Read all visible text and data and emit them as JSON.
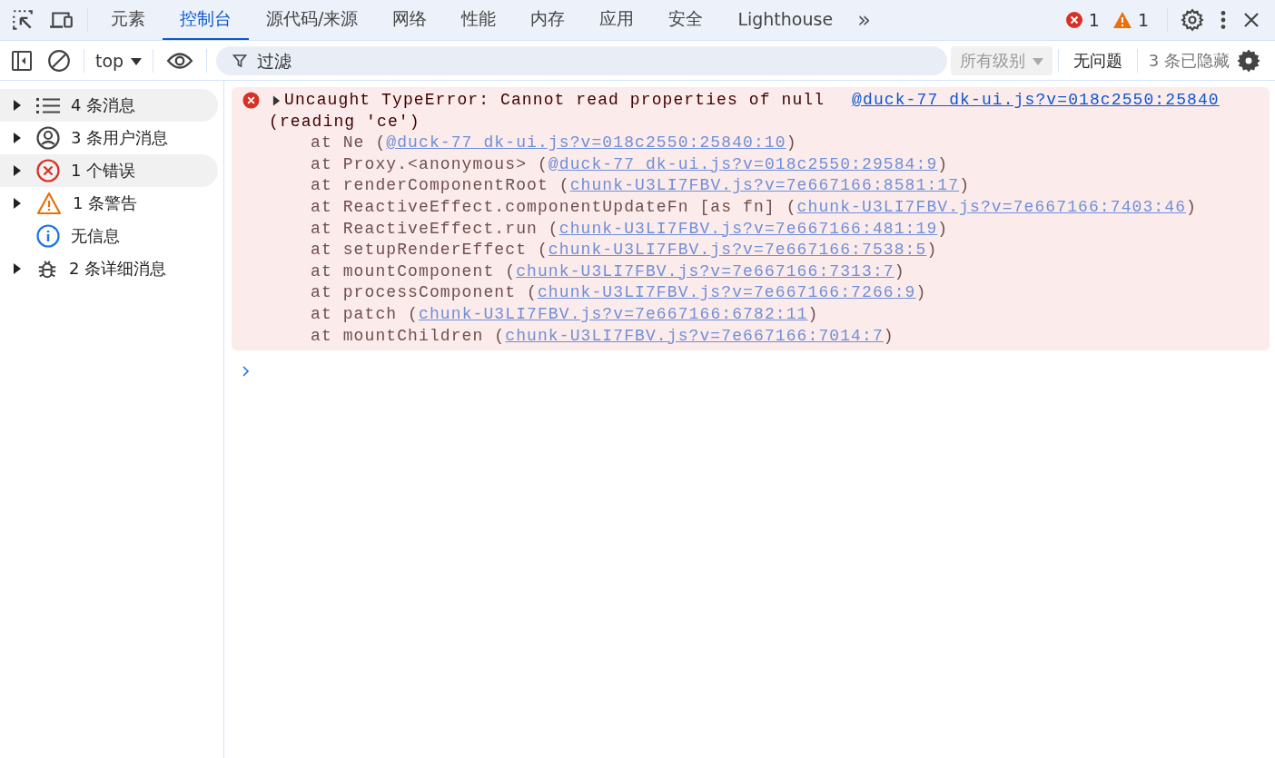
{
  "tabs": [
    {
      "label": "元素",
      "selected": false
    },
    {
      "label": "控制台",
      "selected": true
    },
    {
      "label": "源代码/来源",
      "selected": false
    },
    {
      "label": "网络",
      "selected": false
    },
    {
      "label": "性能",
      "selected": false
    },
    {
      "label": "内存",
      "selected": false
    },
    {
      "label": "应用",
      "selected": false
    },
    {
      "label": "安全",
      "selected": false
    },
    {
      "label": "Lighthouse",
      "selected": false
    }
  ],
  "more_tabs": "»",
  "counters": [
    {
      "kind": "error",
      "count": "1"
    },
    {
      "kind": "warning",
      "count": "1"
    }
  ],
  "toolbar": {
    "context": "top",
    "filter": {
      "placeholder": "过滤"
    },
    "levels": {
      "label": "所有级别",
      "disabled": true
    },
    "issues": "无问题",
    "hidden": "3 条已隐藏"
  },
  "sidebar": [
    {
      "kind": "list",
      "label": "4 条消息",
      "expandable": true,
      "selected": true
    },
    {
      "kind": "user",
      "label": "3 条用户消息",
      "expandable": true,
      "selected": false
    },
    {
      "kind": "error",
      "label": "1 个错误",
      "expandable": true,
      "selected": true
    },
    {
      "kind": "warning",
      "label": "1 条警告",
      "expandable": true,
      "selected": false
    },
    {
      "kind": "info",
      "label": "无信息",
      "expandable": false,
      "selected": false
    },
    {
      "kind": "bug",
      "label": "2 条详细消息",
      "expandable": true,
      "selected": false
    }
  ],
  "error": {
    "message": "Uncaught TypeError: Cannot read properties of null",
    "source": "@duck-77_dk-ui.js?v=018c2550:25840",
    "message_2": "(reading 'ce')",
    "frames": [
      {
        "call": "at Ne (",
        "link": "@duck-77_dk-ui.js?v=018c2550:25840:10",
        "close": ")"
      },
      {
        "call": "at Proxy.<anonymous> (",
        "link": "@duck-77_dk-ui.js?v=018c2550:29584:9",
        "close": ")"
      },
      {
        "call": "at renderComponentRoot (",
        "link": "chunk-U3LI7FBV.js?v=7e667166:8581:17",
        "close": ")"
      },
      {
        "call": "at ReactiveEffect.componentUpdateFn [as fn] (",
        "link": "chunk-U3LI7FBV.js?v=7e667166:7403:46",
        "close": ")"
      },
      {
        "call": "at ReactiveEffect.run (",
        "link": "chunk-U3LI7FBV.js?v=7e667166:481:19",
        "close": ")"
      },
      {
        "call": "at setupRenderEffect (",
        "link": "chunk-U3LI7FBV.js?v=7e667166:7538:5",
        "close": ")"
      },
      {
        "call": "at mountComponent (",
        "link": "chunk-U3LI7FBV.js?v=7e667166:7313:7",
        "close": ")"
      },
      {
        "call": "at processComponent (",
        "link": "chunk-U3LI7FBV.js?v=7e667166:7266:9",
        "close": ")"
      },
      {
        "call": "at patch (",
        "link": "chunk-U3LI7FBV.js?v=7e667166:6782:11",
        "close": ")"
      },
      {
        "call": "at mountChildren (",
        "link": "chunk-U3LI7FBV.js?v=7e667166:7014:7",
        "close": ")"
      }
    ]
  }
}
